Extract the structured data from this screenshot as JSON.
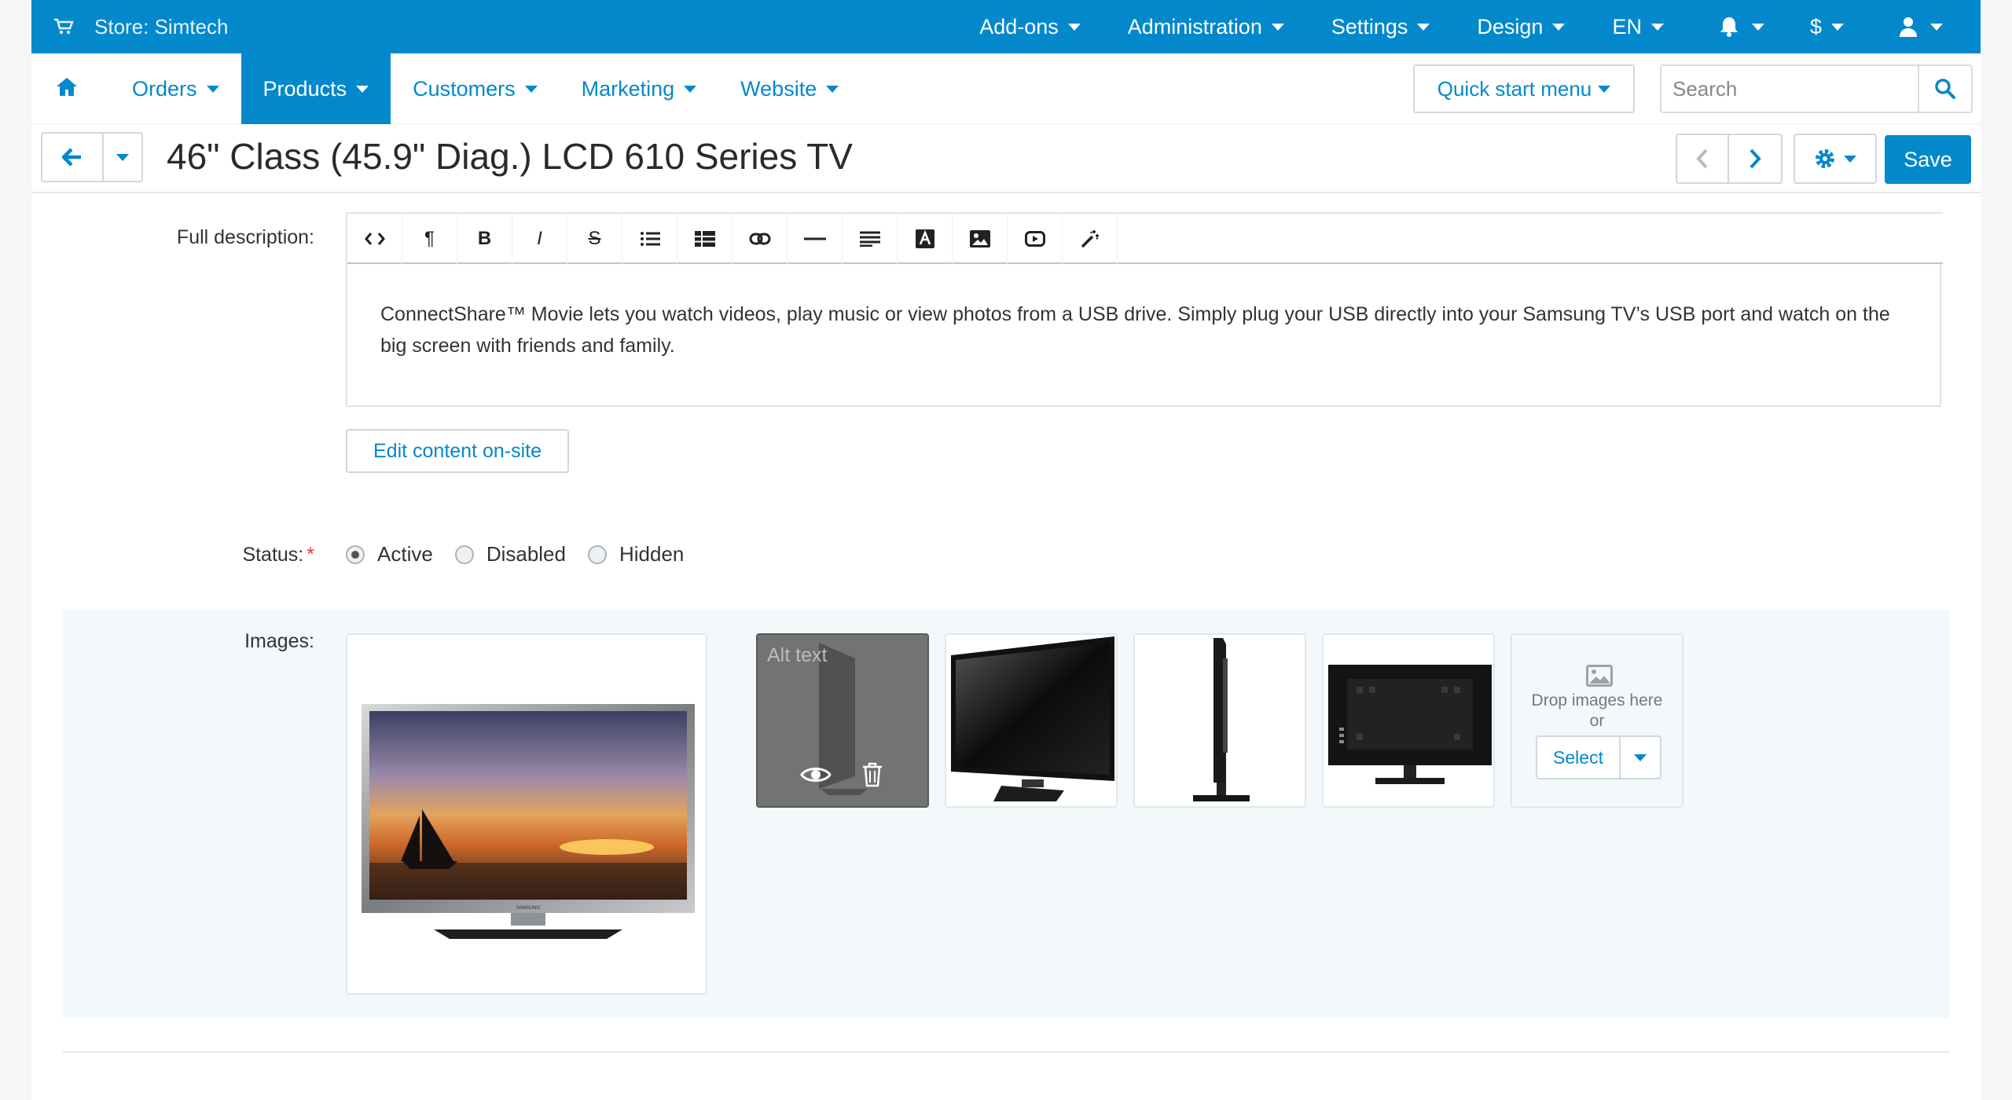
{
  "topbar": {
    "store_label": "Store: Simtech",
    "menu": [
      {
        "label": "Add-ons"
      },
      {
        "label": "Administration"
      },
      {
        "label": "Settings"
      },
      {
        "label": "Design"
      },
      {
        "label": "EN"
      },
      {
        "label": "",
        "icon": "bell-icon"
      },
      {
        "label": "$"
      },
      {
        "label": "",
        "icon": "user-icon"
      }
    ]
  },
  "nav": {
    "items": [
      {
        "label": "Orders",
        "active": false
      },
      {
        "label": "Products",
        "active": true
      },
      {
        "label": "Customers",
        "active": false
      },
      {
        "label": "Marketing",
        "active": false
      },
      {
        "label": "Website",
        "active": false
      }
    ],
    "quick_start_label": "Quick start menu",
    "search_placeholder": "Search"
  },
  "titlebar": {
    "title": "46\" Class (45.9\" Diag.) LCD 610 Series TV",
    "save_label": "Save"
  },
  "form": {
    "full_description_label": "Full description:",
    "toolbar_buttons": [
      "code-icon",
      "paragraph-icon",
      "bold-icon",
      "italic-icon",
      "strikethrough-icon",
      "bullet-list-icon",
      "table-icon",
      "link-icon",
      "horizontal-rule-icon",
      "align-icon",
      "font-color-icon",
      "image-icon",
      "video-icon",
      "magic-wand-icon"
    ],
    "description_text": "ConnectShare™ Movie lets you watch videos, play music or view photos from a USB drive. Simply plug your USB directly into your Samsung TV’s USB port and watch on the big screen with friends and family.",
    "edit_onsite_label": "Edit content on-site",
    "status_label": "Status:",
    "status_options": [
      {
        "label": "Active",
        "checked": true
      },
      {
        "label": "Disabled",
        "checked": false
      },
      {
        "label": "Hidden",
        "checked": false
      }
    ],
    "images_label": "Images:",
    "hover_alt_text": "Alt text",
    "dropzone_text_1": "Drop images here",
    "dropzone_text_2": "or",
    "select_label": "Select"
  },
  "colors": {
    "brand": "#0388cc",
    "panel": "#f3f8fb"
  }
}
